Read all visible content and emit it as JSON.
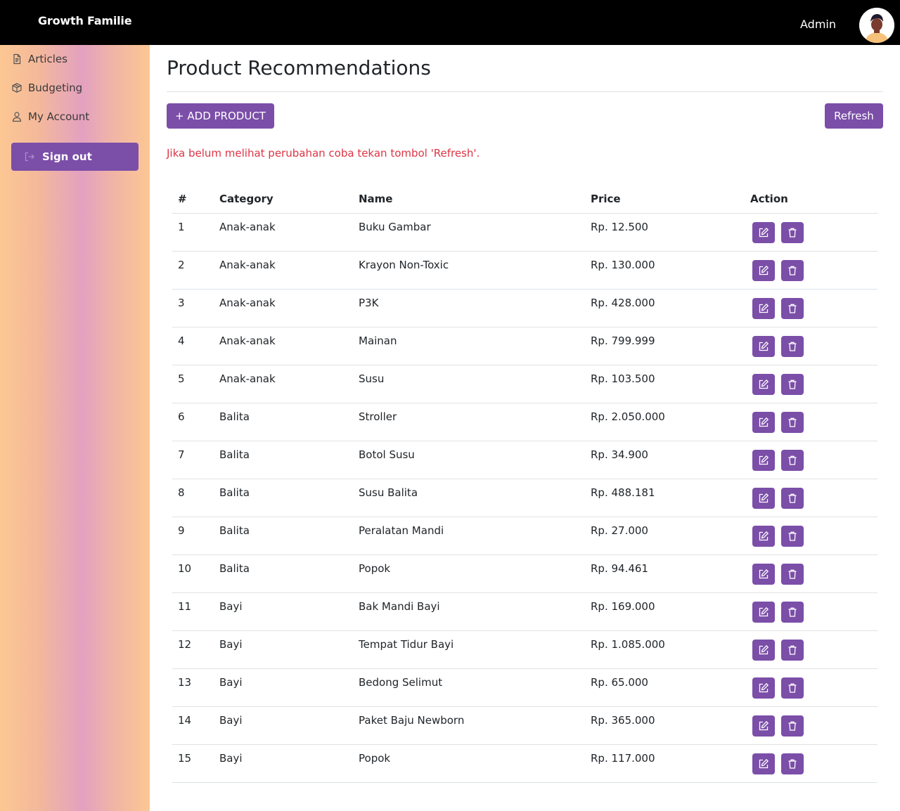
{
  "header": {
    "brand": "Growth Familie",
    "admin_label": "Admin",
    "avatar_icon": "user-avatar-icon"
  },
  "sidebar": {
    "items": [
      {
        "label": "Articles",
        "icon": "document-icon"
      },
      {
        "label": "Budgeting",
        "icon": "box-icon"
      },
      {
        "label": "My Account",
        "icon": "user-icon"
      }
    ],
    "signout_label": "Sign out",
    "signout_icon": "sign-out-icon"
  },
  "main": {
    "title": "Product Recommendations",
    "add_label": "+ ADD PRODUCT",
    "refresh_label": "Refresh",
    "notice": "Jika belum melihat perubahan coba tekan tombol 'Refresh'.",
    "columns": [
      "#",
      "Category",
      "Name",
      "Price",
      "Action"
    ],
    "rows": [
      {
        "num": "1",
        "category": "Anak-anak",
        "name": "Buku Gambar",
        "price": "Rp. 12.500"
      },
      {
        "num": "2",
        "category": "Anak-anak",
        "name": "Krayon Non-Toxic",
        "price": "Rp. 130.000"
      },
      {
        "num": "3",
        "category": "Anak-anak",
        "name": "P3K",
        "price": "Rp. 428.000"
      },
      {
        "num": "4",
        "category": "Anak-anak",
        "name": "Mainan",
        "price": "Rp. 799.999"
      },
      {
        "num": "5",
        "category": "Anak-anak",
        "name": "Susu",
        "price": "Rp. 103.500"
      },
      {
        "num": "6",
        "category": "Balita",
        "name": "Stroller",
        "price": "Rp. 2.050.000"
      },
      {
        "num": "7",
        "category": "Balita",
        "name": "Botol Susu",
        "price": "Rp. 34.900"
      },
      {
        "num": "8",
        "category": "Balita",
        "name": "Susu Balita",
        "price": "Rp. 488.181"
      },
      {
        "num": "9",
        "category": "Balita",
        "name": "Peralatan Mandi",
        "price": "Rp. 27.000"
      },
      {
        "num": "10",
        "category": "Balita",
        "name": "Popok",
        "price": "Rp. 94.461"
      },
      {
        "num": "11",
        "category": "Bayi",
        "name": "Bak Mandi Bayi",
        "price": "Rp. 169.000"
      },
      {
        "num": "12",
        "category": "Bayi",
        "name": "Tempat Tidur Bayi",
        "price": "Rp. 1.085.000"
      },
      {
        "num": "13",
        "category": "Bayi",
        "name": "Bedong Selimut",
        "price": "Rp. 65.000"
      },
      {
        "num": "14",
        "category": "Bayi",
        "name": "Paket Baju Newborn",
        "price": "Rp. 365.000"
      },
      {
        "num": "15",
        "category": "Bayi",
        "name": "Popok",
        "price": "Rp. 117.000"
      }
    ],
    "edit_icon": "edit-icon",
    "delete_icon": "trash-icon"
  },
  "colors": {
    "accent": "#7b4ea8",
    "notice": "#dc3545",
    "topbar": "#000000"
  }
}
